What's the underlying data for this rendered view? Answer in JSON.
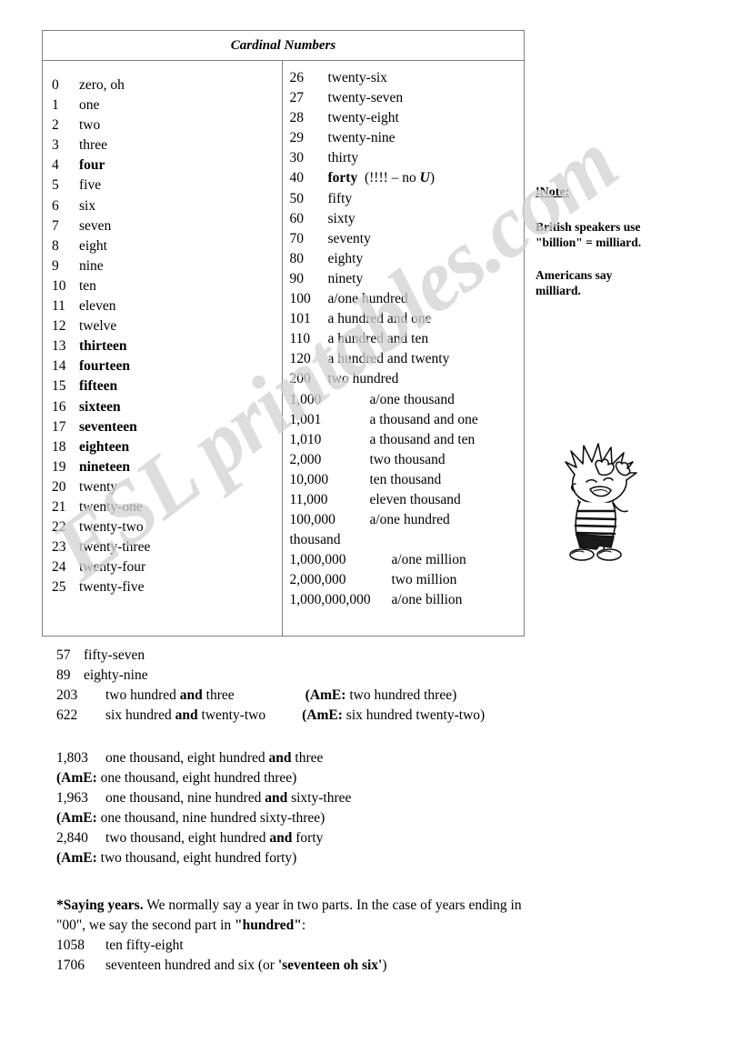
{
  "watermark": {
    "text": "ESL printables.com"
  },
  "table": {
    "title": "Cardinal Numbers",
    "left_column": [
      {
        "num": "0",
        "word": "zero, oh",
        "bold": false
      },
      {
        "num": "1",
        "word": "one",
        "bold": false
      },
      {
        "num": "2",
        "word": "two",
        "bold": false
      },
      {
        "num": "3",
        "word": "three",
        "bold": false
      },
      {
        "num": "4",
        "word": "four",
        "bold": true
      },
      {
        "num": "5",
        "word": "five",
        "bold": false
      },
      {
        "num": "6",
        "word": "six",
        "bold": false
      },
      {
        "num": "7",
        "word": "seven",
        "bold": false
      },
      {
        "num": "8",
        "word": "eight",
        "bold": false
      },
      {
        "num": "9",
        "word": "nine",
        "bold": false
      },
      {
        "num": "10",
        "word": "ten",
        "bold": false
      },
      {
        "num": "11",
        "word": "eleven",
        "bold": false
      },
      {
        "num": "12",
        "word": "twelve",
        "bold": false
      },
      {
        "num": "13",
        "word": "thirteen",
        "bold": true
      },
      {
        "num": "14",
        "word": "fourteen",
        "bold": true
      },
      {
        "num": "15",
        "word": "fifteen",
        "bold": true
      },
      {
        "num": "16",
        "word": "sixteen",
        "bold": true
      },
      {
        "num": "17",
        "word": "seventeen",
        "bold": true
      },
      {
        "num": "18",
        "word": "eighteen",
        "bold": true
      },
      {
        "num": "19",
        "word": "nineteen",
        "bold": true
      },
      {
        "num": "20",
        "word": "twenty",
        "bold": false
      },
      {
        "num": "21",
        "word": "twenty-one",
        "bold": false
      },
      {
        "num": "22",
        "word": "twenty-two",
        "bold": false
      },
      {
        "num": "23",
        "word": "twenty-three",
        "bold": false
      },
      {
        "num": "24",
        "word": "twenty-four",
        "bold": false
      },
      {
        "num": "25",
        "word": "twenty-five",
        "bold": false
      }
    ],
    "right_column": [
      {
        "num": "26",
        "word": "twenty-six",
        "bold": false
      },
      {
        "num": "27",
        "word": "twenty-seven",
        "bold": false
      },
      {
        "num": "28",
        "word": "twenty-eight",
        "bold": false
      },
      {
        "num": "29",
        "word": "twenty-nine",
        "bold": false
      },
      {
        "num": "30",
        "word": "thirty",
        "bold": false
      },
      {
        "num": "40",
        "word": "forty",
        "bold": true,
        "note_pre": "(!!!! – no ",
        "note_italic": "U",
        "note_post": ")"
      },
      {
        "num": "50",
        "word": "fifty",
        "bold": false
      },
      {
        "num": "60",
        "word": "sixty",
        "bold": false
      },
      {
        "num": "70",
        "word": "seventy",
        "bold": false
      },
      {
        "num": "80",
        "word": "eighty",
        "bold": false
      },
      {
        "num": "90",
        "word": "ninety",
        "bold": false
      },
      {
        "num": "100",
        "word": "a/one hundred",
        "bold": false
      },
      {
        "num": "101",
        "word": "a hundred and one",
        "bold": false
      },
      {
        "num": "110",
        "word": "a hundred and ten",
        "bold": false
      },
      {
        "num": "120",
        "word": "a hundred and twenty",
        "bold": false
      },
      {
        "num": "200",
        "word": "two hundred",
        "bold": false
      }
    ],
    "right_column_big": [
      {
        "num": "1,000",
        "word": "a/one thousand",
        "bold": false
      },
      {
        "num": "1,001",
        "word": "a thousand and one",
        "bold": false
      },
      {
        "num": "1,010",
        "word": "a thousand and ten",
        "bold": false
      },
      {
        "num": "2,000",
        "word": "two thousand",
        "bold": false
      },
      {
        "num": "10,000",
        "word": "ten thousand",
        "bold": false
      },
      {
        "num": "11,000",
        "word": "eleven thousand",
        "bold": false
      }
    ],
    "right_column_wrap": {
      "num": "100,000",
      "word": "a/one hundred",
      "word_cont": "thousand"
    },
    "right_column_huge": [
      {
        "num": "1,000,000",
        "word": "a/one million",
        "bold": false
      },
      {
        "num": "2,000,000",
        "word": "two million",
        "bold": false
      },
      {
        "num": "1,000,000,000",
        "word": "a/one billion",
        "bold": false
      }
    ]
  },
  "note": {
    "heading": "!Note:",
    "line1": "British speakers use",
    "line2": "\"billion\" = milliard.",
    "line3": "Americans say",
    "line4": "milliard."
  },
  "examples_basic": [
    {
      "num": "57",
      "pre": "fifty-seven",
      "bold": "",
      "post": "",
      "ame": ""
    },
    {
      "num": "89",
      "pre": "eighty-nine",
      "bold": "",
      "post": "",
      "ame": ""
    },
    {
      "num": "203",
      "pre": "two hundred ",
      "bold": "and",
      "post": " three",
      "ame_bold": "(AmE:",
      "ame_rest": " two hundred three)"
    },
    {
      "num": "622",
      "pre": "six hundred ",
      "bold": "and",
      "post": " twenty-two",
      "ame_bold": "(AmE:",
      "ame_rest": " six hundred twenty-two)"
    }
  ],
  "examples_long": [
    {
      "num": "1,803",
      "pre": "one thousand, eight hundred ",
      "bold": "and",
      "post": " three"
    },
    {
      "ame_bold": "(AmE:",
      "ame_rest": " one thousand, eight hundred three)"
    },
    {
      "num": "1,963",
      "pre": "one thousand, nine hundred ",
      "bold": "and",
      "post": " sixty-three"
    },
    {
      "ame_bold": "(AmE:",
      "ame_rest": " one thousand, nine hundred sixty-three)"
    },
    {
      "num": "2,840",
      "pre": "two thousand, eight hundred ",
      "bold": "and",
      "post": " forty"
    },
    {
      "ame_bold": "(AmE:",
      "ame_rest": " two thousand, eight hundred forty)"
    }
  ],
  "years": {
    "head_bold": "*Saying years.",
    "head_rest": " We normally say a year in two parts. In the case of years ending in",
    "line2_pre": "\"00\", we say the second part in ",
    "line2_bold": "\"hundred\"",
    "line2_post": ":",
    "rows": [
      {
        "num": "1058",
        "pre": "ten fifty-eight",
        "bold": "",
        "post": ""
      },
      {
        "num": "1706",
        "pre": "seventeen hundred and six (or ",
        "bold": "'seventeen oh six'",
        "post": ")"
      }
    ]
  },
  "cartoon": {
    "alt": "calvin-cartoon-boy-holding-head"
  },
  "colors": {
    "border": "#808080",
    "text": "#000000",
    "watermark": "#d2d2d2",
    "page_bg": "#ffffff"
  }
}
